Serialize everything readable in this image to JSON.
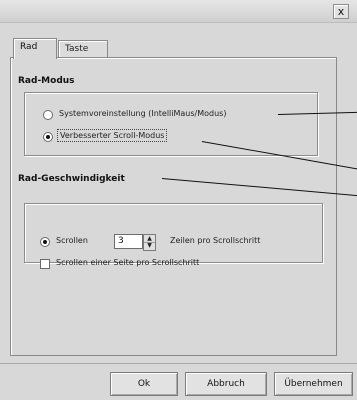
{
  "window": {
    "close_label": "x"
  },
  "tabs": [
    {
      "label": "Rad",
      "active": true
    },
    {
      "label": "Taste",
      "active": false
    }
  ],
  "wheel_mode": {
    "heading": "Rad-Modus",
    "options": [
      {
        "label": "Systemvoreinstellung (IntelliMaus/Modus)",
        "selected": false
      },
      {
        "label": "Verbesserter Scroll-Modus",
        "selected": true
      }
    ]
  },
  "wheel_speed": {
    "heading": "Rad-Geschwindigkeit",
    "scroll_label": "Scrollen",
    "scroll_value": "3",
    "scroll_suffix": "Zeilen pro Scrollschritt",
    "scroll_selected": true,
    "page_option_label": "Scrollen einer Seite pro Scrollschritt",
    "page_option_checked": false
  },
  "buttons": {
    "ok": "Ok",
    "cancel": "Abbruch",
    "apply": "Übernehmen"
  }
}
